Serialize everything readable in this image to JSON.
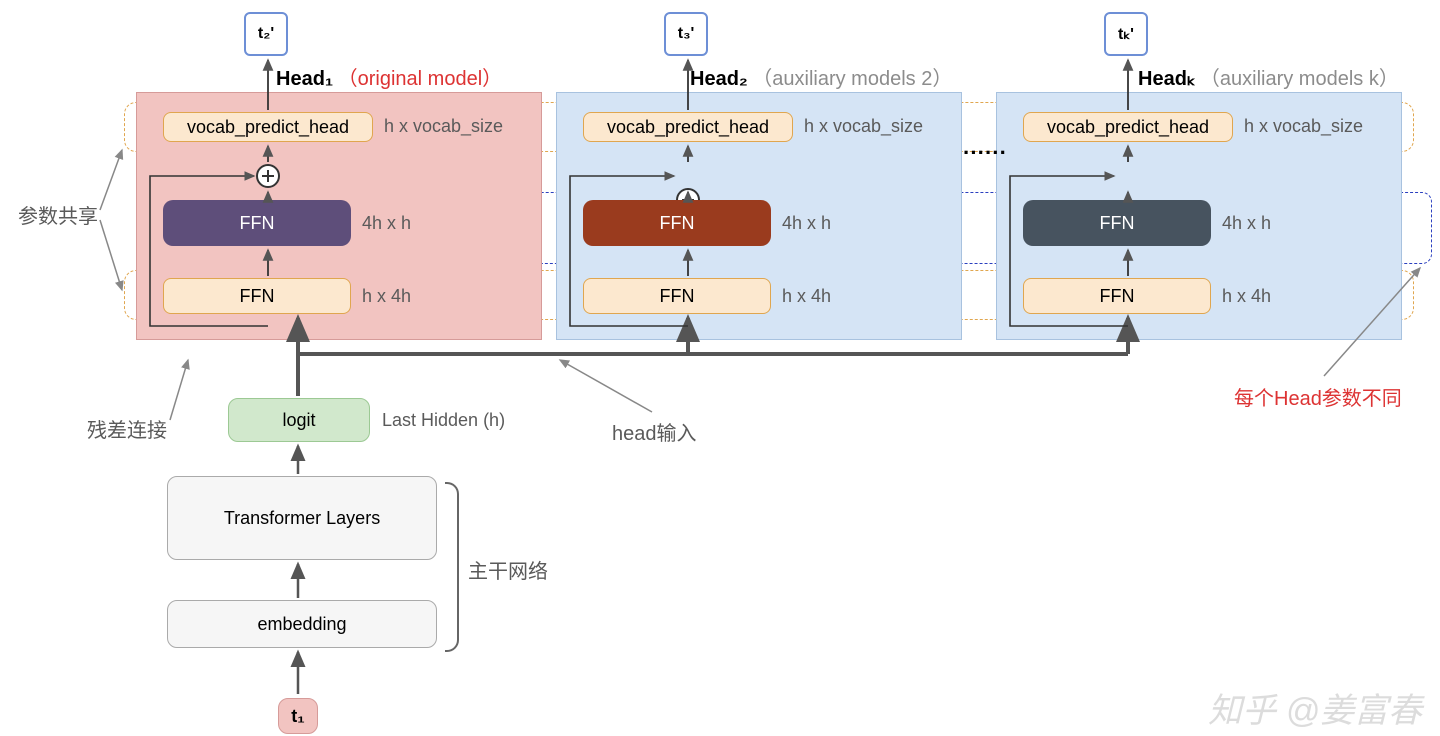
{
  "outputs": {
    "t2": "t₂'",
    "t3": "t₃'",
    "tk": "tₖ'"
  },
  "heads": {
    "h1": {
      "title": "Head₁",
      "sub": "（original model）"
    },
    "h2": {
      "title": "Head₂",
      "sub": "（auxiliary models 2）"
    },
    "hk": {
      "title": "Headₖ",
      "sub": "（auxiliary models k）"
    }
  },
  "blocks": {
    "vph": "vocab_predict_head",
    "vph_dim": "h x vocab_size",
    "ffn": "FFN",
    "ffn_up_dim": "4h x h",
    "ffn_down_dim": "h x 4h",
    "logit": "logit",
    "logit_dim": "Last Hidden (h)",
    "transformer": "Transformer Layers",
    "embedding": "embedding",
    "input_token": "t₁"
  },
  "annotations": {
    "param_share": "参数共享",
    "residual": "残差连接",
    "backbone": "主干网络",
    "head_input": "head输入",
    "head_uniq": "每个Head参数不同",
    "ellipsis": "······"
  },
  "watermark": "知乎 @姜富春"
}
